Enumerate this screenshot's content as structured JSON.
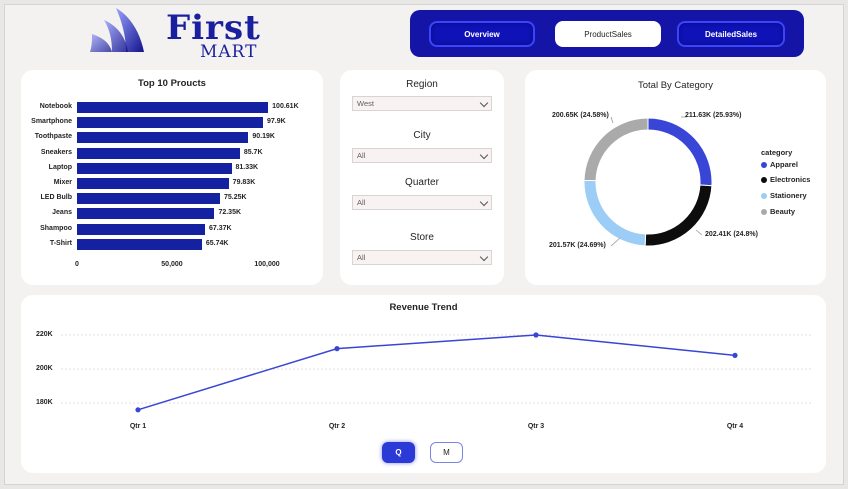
{
  "brand": {
    "name": "First",
    "sub": "MART"
  },
  "nav": {
    "tabs": [
      {
        "label": "Overview",
        "active": false
      },
      {
        "label": "ProductSales",
        "active": true
      },
      {
        "label": "DetailedSales",
        "active": false
      }
    ]
  },
  "top_products": {
    "title": "Top 10 Proucts",
    "chart_data": {
      "type": "bar",
      "orientation": "horizontal",
      "categories": [
        "Notebook",
        "Smartphone",
        "Toothpaste",
        "Sneakers",
        "Laptop",
        "Mixer",
        "LED Bulb",
        "Jeans",
        "Shampoo",
        "T-Shirt"
      ],
      "values": [
        100610,
        97900,
        90190,
        85700,
        81330,
        79830,
        75250,
        72350,
        67370,
        65740
      ],
      "data_labels": [
        "100.61K",
        "97.9K",
        "90.19K",
        "85.7K",
        "81.33K",
        "79.83K",
        "75.25K",
        "72.35K",
        "67.37K",
        "65.74K"
      ],
      "x_ticks": [
        "0",
        "50,000",
        "100,000"
      ],
      "xlim": [
        0,
        100000
      ],
      "color": "#1421a1"
    }
  },
  "slicers": [
    {
      "label": "Region",
      "value": "West"
    },
    {
      "label": "City",
      "value": "All"
    },
    {
      "label": "Quarter",
      "value": "All"
    },
    {
      "label": "Store",
      "value": "All"
    }
  ],
  "category_chart": {
    "title": "Total By Category",
    "legend_title": "category",
    "chart_data": {
      "type": "pie",
      "style": "donut",
      "categories": [
        "Apparel",
        "Electronics",
        "Stationery",
        "Beauty"
      ],
      "values": [
        211630,
        202410,
        201570,
        200650
      ],
      "data_labels": [
        "211.63K (25.93%)",
        "202.41K (24.8%)",
        "201.57K (24.69%)",
        "200.65K (24.58%)"
      ],
      "colors": [
        "#3845d6",
        "#0d0d0d",
        "#9ccdf7",
        "#aaaaaa"
      ],
      "legend_position": "right"
    }
  },
  "revenue_trend": {
    "title": "Revenue Trend",
    "chart_data": {
      "type": "line",
      "x": [
        "Qtr 1",
        "Qtr 2",
        "Qtr 3",
        "Qtr 4"
      ],
      "values": [
        176000,
        212000,
        220000,
        208000
      ],
      "y_ticks": [
        "220K",
        "200K",
        "180K"
      ],
      "y_tick_values": [
        220000,
        200000,
        180000
      ],
      "ylim": [
        170000,
        228000
      ],
      "grid": true,
      "color": "#3845d6"
    },
    "toggles": [
      {
        "label": "Q",
        "active": true
      },
      {
        "label": "M",
        "active": false
      }
    ]
  }
}
